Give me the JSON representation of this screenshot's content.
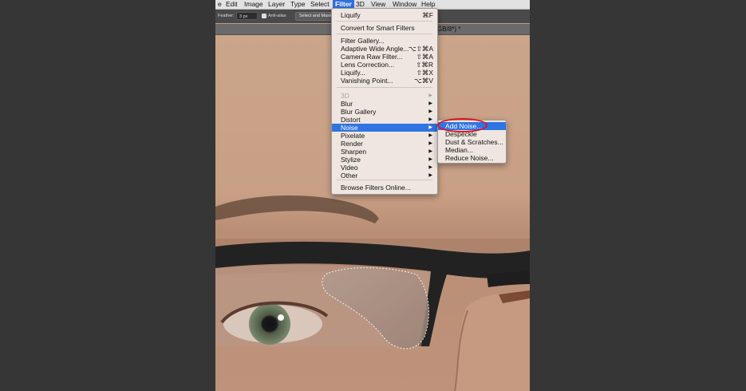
{
  "menubar": {
    "items": [
      "e",
      "Edit",
      "Image",
      "Layer",
      "Type",
      "Select",
      "Filter",
      "3D",
      "View",
      "Window",
      "Help"
    ],
    "active_index": 6
  },
  "options_bar": {
    "feather_label": "Feather:",
    "feather_value": "3 px",
    "antialias_label": "Anti-alias",
    "antialias_checked": true,
    "select_mask_label": "Select and Mask..."
  },
  "document_tab": {
    "title_fragment": "GB/8*) *"
  },
  "filter_menu": {
    "items": [
      {
        "label": "Liquify",
        "shortcut": "⌘F",
        "submenu": false,
        "disabled": false
      },
      {
        "label": "Convert for Smart Filters",
        "shortcut": "",
        "submenu": false,
        "disabled": false
      },
      {
        "label": "Filter Gallery...",
        "shortcut": "",
        "submenu": false,
        "disabled": false
      },
      {
        "label": "Adaptive Wide Angle...",
        "shortcut": "⌥⇧⌘A",
        "submenu": false,
        "disabled": false
      },
      {
        "label": "Camera Raw Filter...",
        "shortcut": "⇧⌘A",
        "submenu": false,
        "disabled": false
      },
      {
        "label": "Lens Correction...",
        "shortcut": "⇧⌘R",
        "submenu": false,
        "disabled": false
      },
      {
        "label": "Liquify...",
        "shortcut": "⇧⌘X",
        "submenu": false,
        "disabled": false
      },
      {
        "label": "Vanishing Point...",
        "shortcut": "⌥⌘V",
        "submenu": false,
        "disabled": false
      },
      {
        "label": "3D",
        "shortcut": "",
        "submenu": true,
        "disabled": true
      },
      {
        "label": "Blur",
        "shortcut": "",
        "submenu": true,
        "disabled": false
      },
      {
        "label": "Blur Gallery",
        "shortcut": "",
        "submenu": true,
        "disabled": false
      },
      {
        "label": "Distort",
        "shortcut": "",
        "submenu": true,
        "disabled": false
      },
      {
        "label": "Noise",
        "shortcut": "",
        "submenu": true,
        "disabled": false,
        "highlighted": true
      },
      {
        "label": "Pixelate",
        "shortcut": "",
        "submenu": true,
        "disabled": false
      },
      {
        "label": "Render",
        "shortcut": "",
        "submenu": true,
        "disabled": false
      },
      {
        "label": "Sharpen",
        "shortcut": "",
        "submenu": true,
        "disabled": false
      },
      {
        "label": "Stylize",
        "shortcut": "",
        "submenu": true,
        "disabled": false
      },
      {
        "label": "Video",
        "shortcut": "",
        "submenu": true,
        "disabled": false
      },
      {
        "label": "Other",
        "shortcut": "",
        "submenu": true,
        "disabled": false
      },
      {
        "label": "Browse Filters Online...",
        "shortcut": "",
        "submenu": false,
        "disabled": false
      }
    ],
    "submenu_arrow": "▶"
  },
  "noise_submenu": {
    "items": [
      {
        "label": "Add Noise...",
        "highlighted": true
      },
      {
        "label": "Despeckle",
        "highlighted": false
      },
      {
        "label": "Dust & Scratches...",
        "highlighted": false
      },
      {
        "label": "Median...",
        "highlighted": false
      },
      {
        "label": "Reduce Noise...",
        "highlighted": false
      }
    ]
  },
  "colors": {
    "highlight": "#2f74e3",
    "annotation_ring": "#e0141e",
    "glasses_frame": "#222222",
    "skin": "#c79f85"
  }
}
